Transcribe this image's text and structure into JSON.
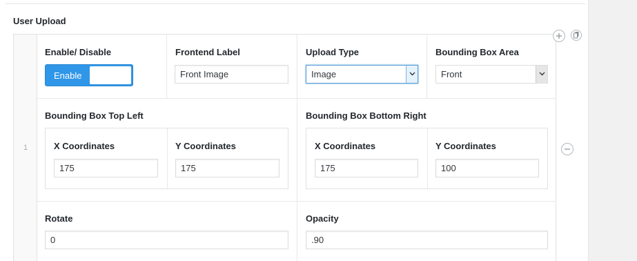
{
  "section": {
    "title": "User Upload"
  },
  "row": {
    "index": "1"
  },
  "enable": {
    "label": "Enable/ Disable",
    "toggle_text": "Enable"
  },
  "frontend_label": {
    "label": "Frontend Label",
    "value": "Front Image"
  },
  "upload_type": {
    "label": "Upload Type",
    "selected": "Image"
  },
  "bounding_area": {
    "label": "Bounding Box Area",
    "selected": "Front"
  },
  "top_left": {
    "label": "Bounding Box Top Left",
    "x_label": "X Coordinates",
    "x_value": "175",
    "y_label": "Y Coordinates",
    "y_value": "175"
  },
  "bottom_right": {
    "label": "Bounding Box Bottom Right",
    "x_label": "X Coordinates",
    "x_value": "175",
    "y_label": "Y Coordinates",
    "y_value": "100"
  },
  "rotate": {
    "label": "Rotate",
    "value": "0"
  },
  "opacity": {
    "label": "Opacity",
    "value": ".90"
  },
  "colors": {
    "toggle_on": "#2f96e8",
    "focus_border": "#5b9dd9"
  }
}
